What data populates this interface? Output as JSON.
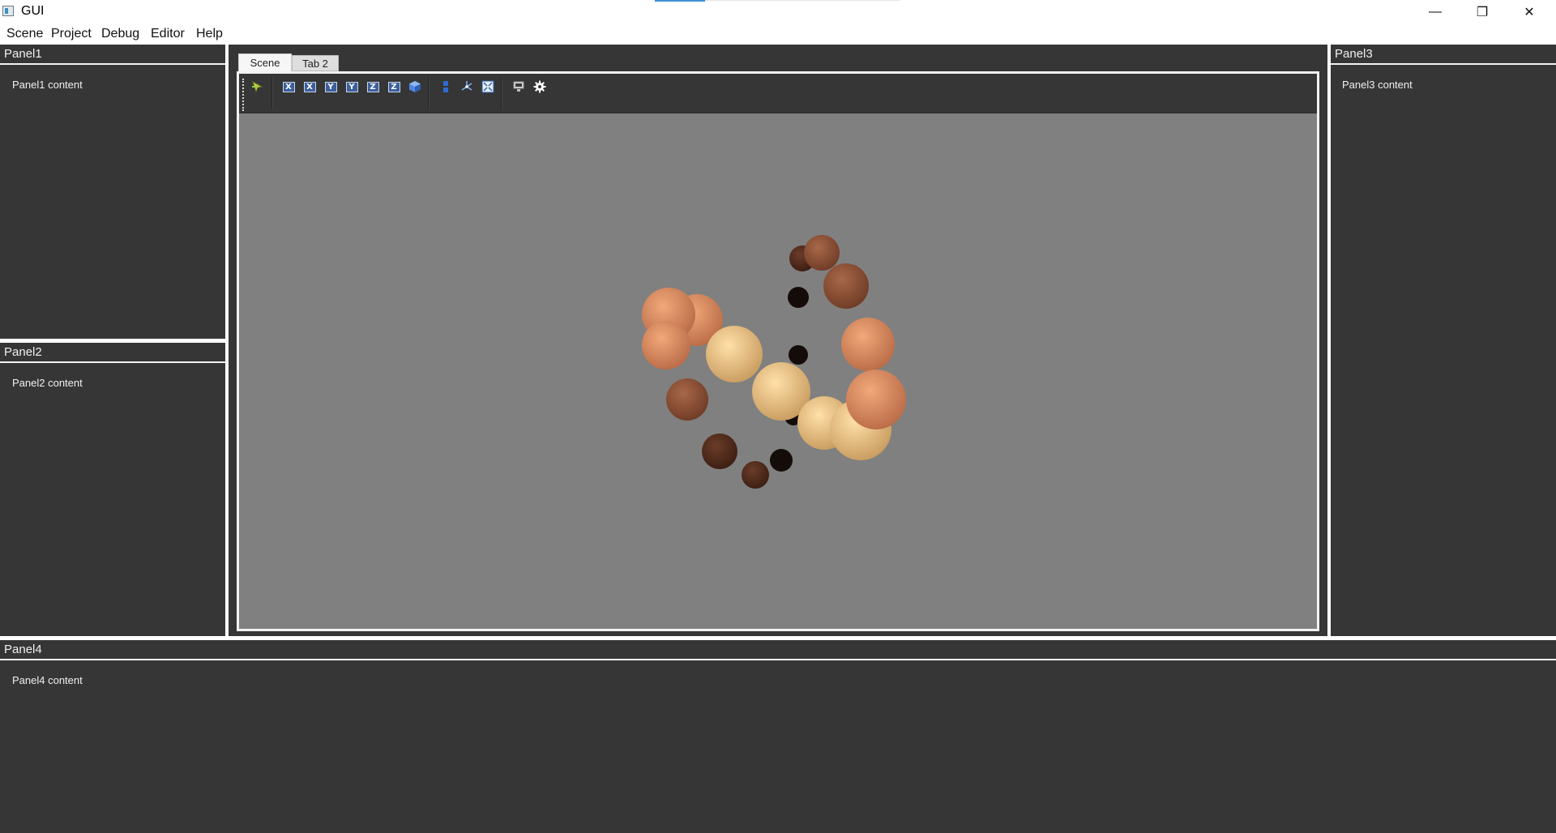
{
  "window": {
    "title": "GUI",
    "minimize_glyph": "—",
    "restore_glyph": "❐",
    "close_glyph": "✕"
  },
  "menubar": {
    "items": [
      "Scene",
      "Project",
      "Debug",
      "Editor",
      "Help"
    ]
  },
  "panels": {
    "panel1": {
      "title": "Panel1",
      "content": "Panel1 content"
    },
    "panel2": {
      "title": "Panel2",
      "content": "Panel2 content"
    },
    "panel3": {
      "title": "Panel3",
      "content": "Panel3 content"
    },
    "panel4": {
      "title": "Panel4",
      "content": "Panel4 content"
    }
  },
  "tabs": [
    {
      "label": "Scene",
      "active": true
    },
    {
      "label": "Tab 2",
      "active": false
    }
  ],
  "toolbar": {
    "buttons": [
      {
        "name": "select-tool-icon"
      },
      {
        "name": "view-x-pos-icon",
        "label": "X"
      },
      {
        "name": "view-x-neg-icon",
        "label": "X"
      },
      {
        "name": "view-y-pos-icon",
        "label": "Y"
      },
      {
        "name": "view-y-neg-icon",
        "label": "Y"
      },
      {
        "name": "view-z-pos-icon",
        "label": "Z"
      },
      {
        "name": "view-z-neg-icon",
        "label": "Z"
      },
      {
        "name": "perspective-cube-icon"
      },
      {
        "name": "layers-icon"
      },
      {
        "name": "transform-gizmo-icon"
      },
      {
        "name": "fit-view-icon"
      },
      {
        "name": "render-monitor-icon"
      },
      {
        "name": "settings-gear-icon"
      }
    ]
  },
  "scene": {
    "background_color": "#808080",
    "objects": "spheres"
  },
  "colors": {
    "panel_bg": "#353635",
    "text": "#f0f0f0",
    "axis_icon": "#3d5f9c"
  }
}
